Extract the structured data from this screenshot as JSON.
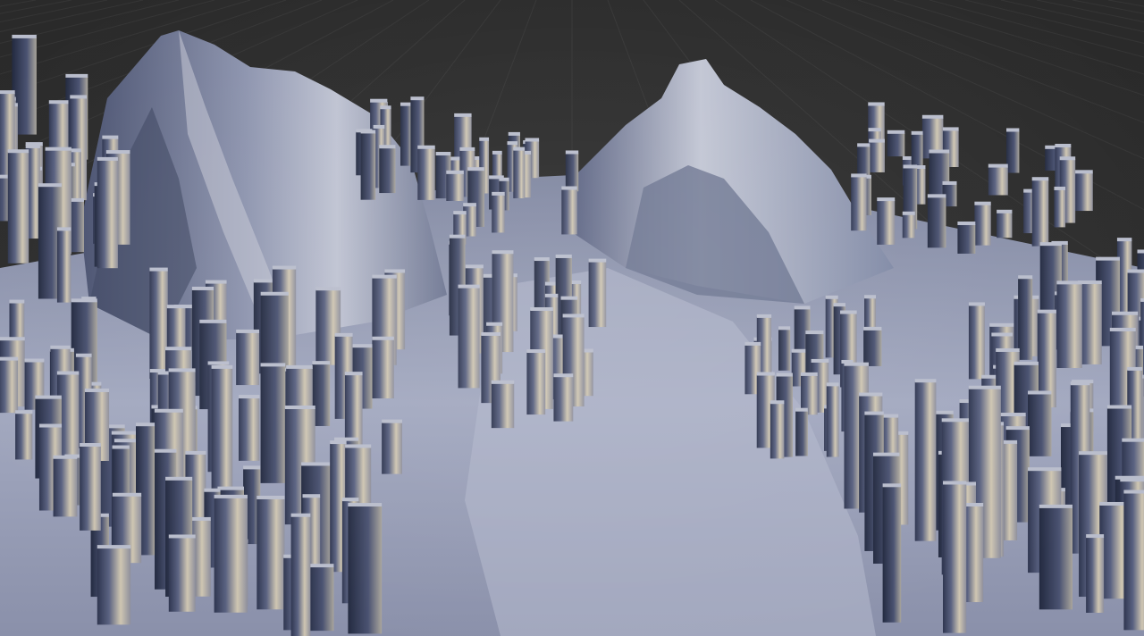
{
  "scene": {
    "description_label": "",
    "colors": {
      "background": "#2b2b2b",
      "grid_line": "#3a3a3a",
      "terrain_light": "#c9ccd6",
      "terrain_mid": "#8e95ad",
      "terrain_shadow": "#3f4763",
      "terrain_deep": "#252b40",
      "highlight_warm": "#e8dcc4"
    }
  }
}
